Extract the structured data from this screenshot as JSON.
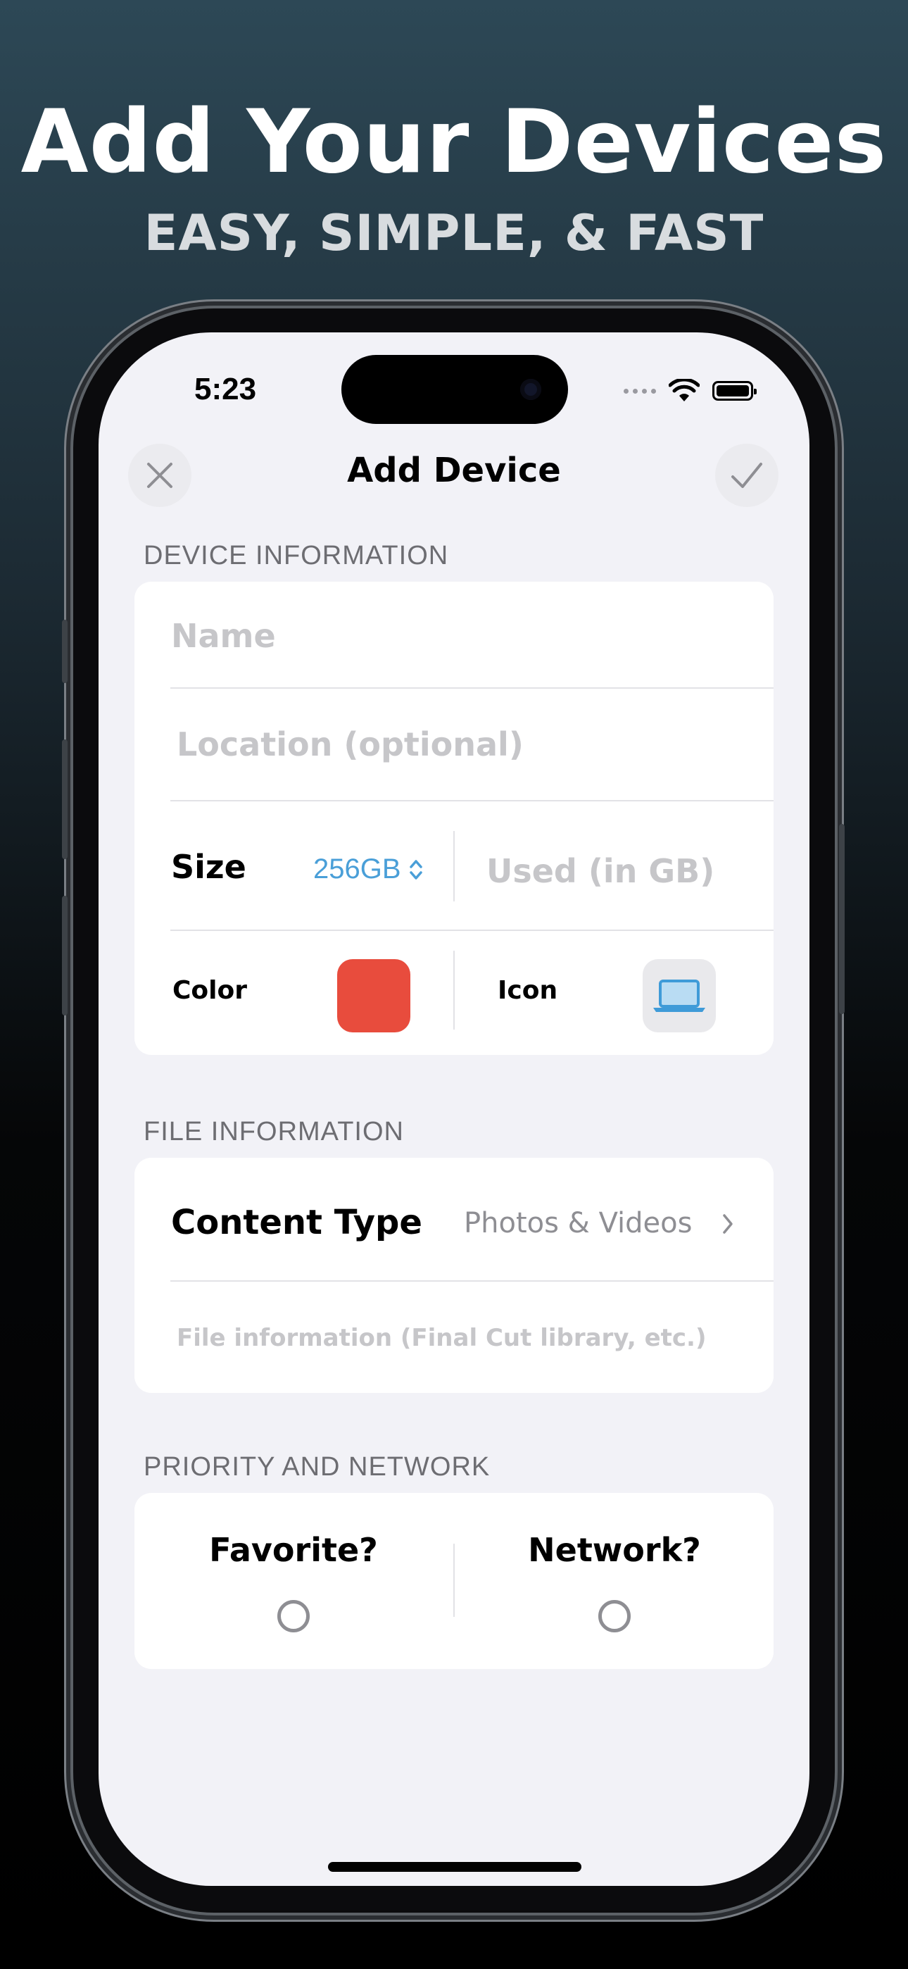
{
  "hero": {
    "title": "Add Your Devices",
    "subtitle": "EASY, SIMPLE, & FAST"
  },
  "status_bar": {
    "time": "5:23",
    "icons": [
      "cellular-dots-icon",
      "wifi-icon",
      "battery-icon"
    ]
  },
  "nav": {
    "title": "Add Device",
    "close_icon": "close-icon",
    "confirm_icon": "checkmark-icon"
  },
  "device_information": {
    "header": "DEVICE INFORMATION",
    "name_placeholder": "Name",
    "location_placeholder": "Location (optional)",
    "size_label": "Size",
    "size_value": "256GB",
    "used_placeholder": "Used (in GB)",
    "color_label": "Color",
    "color_value": "#E84C3D",
    "icon_label": "Icon",
    "icon_value": "laptop-icon"
  },
  "file_information": {
    "header": "FILE INFORMATION",
    "content_type_label": "Content Type",
    "content_type_value": "Photos & Videos",
    "file_info_placeholder": "File information (Final Cut library, etc.)"
  },
  "priority_network": {
    "header": "PRIORITY AND NETWORK",
    "favorite_label": "Favorite?",
    "favorite_checked": false,
    "network_label": "Network?",
    "network_checked": false
  },
  "colors": {
    "accent": "#4A9FD8",
    "swatch": "#E84C3D",
    "background_top": "#2D4856",
    "background_bottom": "#000000"
  }
}
